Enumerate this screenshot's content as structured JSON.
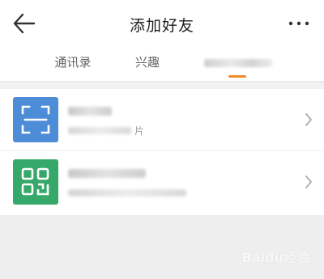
{
  "header": {
    "title": "添加好友",
    "back_icon": "arrow-left-icon",
    "more_icon": "more-dots-icon"
  },
  "tabs": [
    {
      "label": "通讯录"
    },
    {
      "label": "兴趣"
    },
    {
      "label": "",
      "active": true
    }
  ],
  "items": [
    {
      "icon": "scan-icon",
      "title": "",
      "subtitle_tail": "片"
    },
    {
      "icon": "qr-code-icon",
      "title": "",
      "subtitle_tail": ""
    }
  ],
  "watermark": "Baidu经验",
  "colors": {
    "accent": "#f08a2b",
    "scan_icon_bg": "#4d8cd6",
    "qr_icon_bg": "#35a86a",
    "divider": "#eeeeee"
  }
}
